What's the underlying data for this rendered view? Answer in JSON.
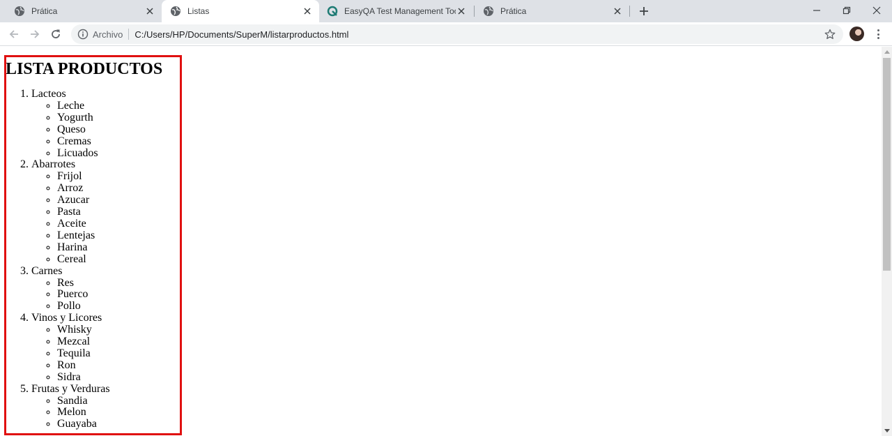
{
  "browser": {
    "tabs": [
      {
        "title": "Prática",
        "favicon": "globe-icon",
        "active": false
      },
      {
        "title": "Listas",
        "favicon": "globe-icon",
        "active": true
      },
      {
        "title": "EasyQA Test Management Tool",
        "favicon": "easyqa-icon",
        "active": false
      },
      {
        "title": "Prática",
        "favicon": "globe-icon",
        "active": false
      }
    ],
    "address": {
      "scheme_label": "Archivo",
      "url": "C:/Users/HP/Documents/SuperM/listarproductos.html"
    }
  },
  "page": {
    "heading": "LISTA PRODUCTOS",
    "categories": [
      {
        "name": "Lacteos",
        "items": [
          "Leche",
          "Yogurth",
          "Queso",
          "Cremas",
          "Licuados"
        ]
      },
      {
        "name": "Abarrotes",
        "items": [
          "Frijol",
          "Arroz",
          "Azucar",
          "Pasta",
          "Aceite",
          "Lentejas",
          "Harina",
          "Cereal"
        ]
      },
      {
        "name": "Carnes",
        "items": [
          "Res",
          "Puerco",
          "Pollo"
        ]
      },
      {
        "name": "Vinos y Licores",
        "items": [
          "Whisky",
          "Mezcal",
          "Tequila",
          "Ron",
          "Sidra"
        ]
      },
      {
        "name": "Frutas y Verduras",
        "items": [
          "Sandia",
          "Melon",
          "Guayaba"
        ]
      }
    ]
  },
  "colors": {
    "highlight_border": "#e01010",
    "tabstrip": "#dee1e6"
  }
}
